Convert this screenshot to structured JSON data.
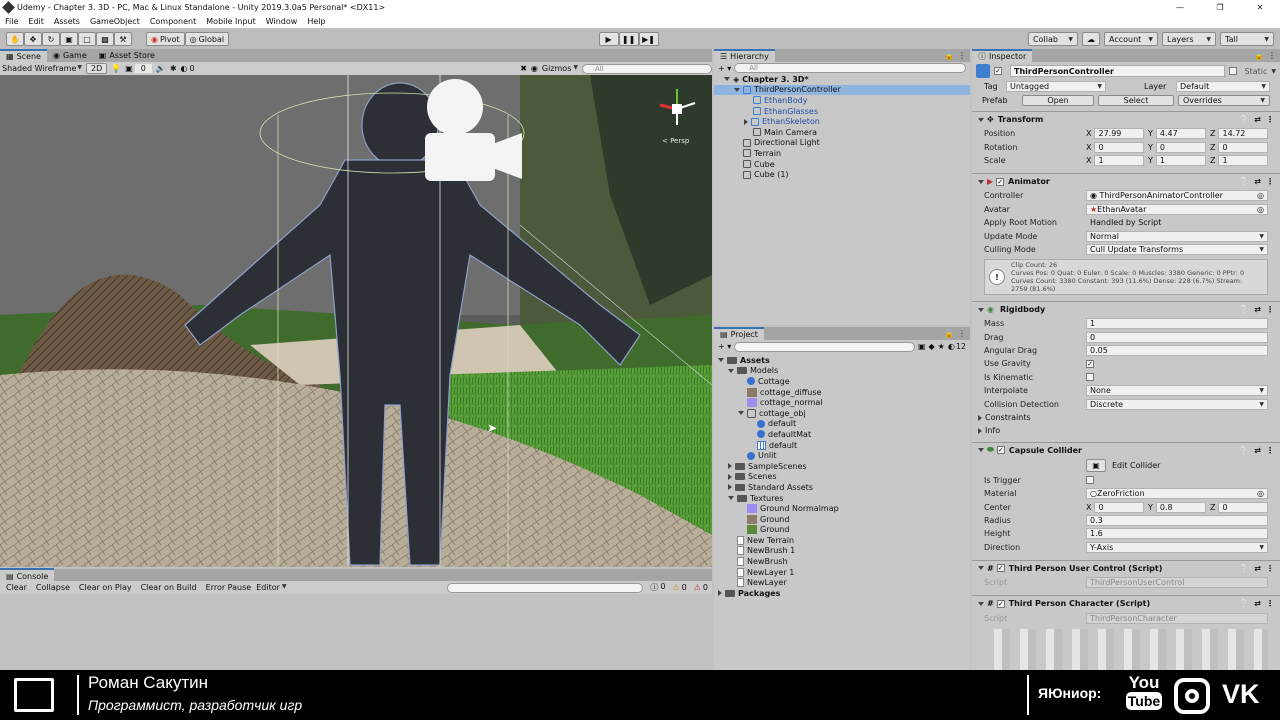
{
  "window": {
    "title": "Udemy - Chapter 3. 3D - PC, Mac & Linux Standalone - Unity 2019.3.0a5 Personal* <DX11>"
  },
  "menu": [
    "File",
    "Edit",
    "Assets",
    "GameObject",
    "Component",
    "Mobile Input",
    "Window",
    "Help"
  ],
  "toolbar": {
    "pivot": "Pivot",
    "global": "Global",
    "collab": "Collab",
    "account": "Account",
    "layers": "Layers",
    "layout": "Tall"
  },
  "scene": {
    "tabs": [
      "Scene",
      "Game",
      "Asset Store"
    ],
    "shading": "Shaded Wireframe",
    "mode2d": "2D",
    "fx_count": "0",
    "hidden_count": "0",
    "gizmos": "Gizmos",
    "search_placeholder": "All",
    "persp": "< Persp"
  },
  "console": {
    "tab": "Console",
    "buttons": [
      "Clear",
      "Collapse",
      "Clear on Play",
      "Clear on Build",
      "Error Pause",
      "Editor"
    ],
    "counts": [
      "0",
      "0",
      "0"
    ]
  },
  "hierarchy": {
    "title": "Hierarchy",
    "search_placeholder": "All",
    "scene": "Chapter 3. 3D*",
    "items": [
      {
        "label": "ThirdPersonController",
        "depth": 1,
        "blue": false,
        "selected": true,
        "arrow": "down"
      },
      {
        "label": "EthanBody",
        "depth": 2,
        "blue": true,
        "selected": false,
        "arrow": ""
      },
      {
        "label": "EthanGlasses",
        "depth": 2,
        "blue": true,
        "selected": false,
        "arrow": ""
      },
      {
        "label": "EthanSkeleton",
        "depth": 2,
        "blue": true,
        "selected": false,
        "arrow": "right"
      },
      {
        "label": "Main Camera",
        "depth": 2,
        "blue": false,
        "selected": false,
        "arrow": ""
      },
      {
        "label": "Directional Light",
        "depth": 1,
        "blue": false,
        "selected": false,
        "arrow": ""
      },
      {
        "label": "Terrain",
        "depth": 1,
        "blue": false,
        "selected": false,
        "arrow": ""
      },
      {
        "label": "Cube",
        "depth": 1,
        "blue": false,
        "selected": false,
        "arrow": ""
      },
      {
        "label": "Cube (1)",
        "depth": 1,
        "blue": false,
        "selected": false,
        "arrow": ""
      }
    ]
  },
  "project": {
    "title": "Project",
    "count": "12",
    "items": [
      {
        "label": "Assets",
        "depth": 0,
        "kind": "folder",
        "arrow": "down",
        "bold": true
      },
      {
        "label": "Models",
        "depth": 1,
        "kind": "folder",
        "arrow": "down"
      },
      {
        "label": "Cottage",
        "depth": 2,
        "kind": "sphere",
        "arrow": ""
      },
      {
        "label": "cottage_diffuse",
        "depth": 2,
        "kind": "tex",
        "arrow": ""
      },
      {
        "label": "cottage_normal",
        "depth": 2,
        "kind": "texn",
        "arrow": ""
      },
      {
        "label": "cottage_obj",
        "depth": 2,
        "kind": "prefab",
        "arrow": "down"
      },
      {
        "label": "default",
        "depth": 3,
        "kind": "sphere",
        "arrow": ""
      },
      {
        "label": "defaultMat",
        "depth": 3,
        "kind": "sphere",
        "arrow": ""
      },
      {
        "label": "default",
        "depth": 3,
        "kind": "mesh",
        "arrow": ""
      },
      {
        "label": "Unlit",
        "depth": 2,
        "kind": "sphere",
        "arrow": ""
      },
      {
        "label": "SampleScenes",
        "depth": 1,
        "kind": "folder",
        "arrow": "right"
      },
      {
        "label": "Scenes",
        "depth": 1,
        "kind": "folder",
        "arrow": "right"
      },
      {
        "label": "Standard Assets",
        "depth": 1,
        "kind": "folder",
        "arrow": "right"
      },
      {
        "label": "Textures",
        "depth": 1,
        "kind": "folder",
        "arrow": "down"
      },
      {
        "label": "Ground Normalmap",
        "depth": 2,
        "kind": "texn",
        "arrow": ""
      },
      {
        "label": "Ground",
        "depth": 2,
        "kind": "tex",
        "arrow": ""
      },
      {
        "label": "Ground",
        "depth": 2,
        "kind": "tex2",
        "arrow": ""
      },
      {
        "label": "New Terrain",
        "depth": 1,
        "kind": "file",
        "arrow": ""
      },
      {
        "label": "NewBrush 1",
        "depth": 1,
        "kind": "file",
        "arrow": ""
      },
      {
        "label": "NewBrush",
        "depth": 1,
        "kind": "file",
        "arrow": ""
      },
      {
        "label": "NewLayer 1",
        "depth": 1,
        "kind": "file",
        "arrow": ""
      },
      {
        "label": "NewLayer",
        "depth": 1,
        "kind": "file",
        "arrow": ""
      },
      {
        "label": "Packages",
        "depth": 0,
        "kind": "folder",
        "arrow": "right",
        "bold": true
      }
    ]
  },
  "inspector": {
    "title": "Inspector",
    "object_name": "ThirdPersonController",
    "static": "Static",
    "tag_label": "Tag",
    "tag": "Untagged",
    "layer_label": "Layer",
    "layer": "Default",
    "prefab_label": "Prefab",
    "open": "Open",
    "select": "Select",
    "overrides": "Overrides",
    "transform": {
      "title": "Transform",
      "position_label": "Position",
      "position": [
        "27.99",
        "4.47",
        "14.72"
      ],
      "rotation_label": "Rotation",
      "rotation": [
        "0",
        "0",
        "0"
      ],
      "scale_label": "Scale",
      "scale": [
        "1",
        "1",
        "1"
      ]
    },
    "animator": {
      "title": "Animator",
      "controller_label": "Controller",
      "controller": "ThirdPersonAnimatorController",
      "avatar_label": "Avatar",
      "avatar": "EthanAvatar",
      "root_motion_label": "Apply Root Motion",
      "root_motion": "Handled by Script",
      "update_label": "Update Mode",
      "update": "Normal",
      "culling_label": "Culling Mode",
      "culling": "Cull Update Transforms",
      "info": [
        "Clip Count: 26",
        "Curves Pos: 0 Quat: 0 Euler: 0 Scale: 0 Muscles: 3380 Generic: 0 PPtr: 0",
        "Curves Count: 3380 Constant: 393 (11.6%) Dense: 228 (6.7%) Stream:",
        "2759 (81.6%)"
      ]
    },
    "rigidbody": {
      "title": "Rigidbody",
      "mass_label": "Mass",
      "mass": "1",
      "drag_label": "Drag",
      "drag": "0",
      "angular_label": "Angular Drag",
      "angular": "0.05",
      "gravity_label": "Use Gravity",
      "kinematic_label": "Is Kinematic",
      "interp_label": "Interpolate",
      "interp": "None",
      "collision_label": "Collision Detection",
      "collision": "Discrete",
      "constraints": "Constraints",
      "info": "Info"
    },
    "capsule": {
      "title": "Capsule Collider",
      "edit": "Edit Collider",
      "trigger_label": "Is Trigger",
      "material_label": "Material",
      "material": "ZeroFriction",
      "center_label": "Center",
      "center": [
        "0",
        "0.8",
        "0"
      ],
      "radius_label": "Radius",
      "radius": "0.3",
      "height_label": "Height",
      "height": "1.6",
      "direction_label": "Direction",
      "direction": "Y-Axis"
    },
    "user_control": {
      "title": "Third Person User Control (Script)",
      "script_label": "Script",
      "script": "ThirdPersonUserControl"
    },
    "character": {
      "title": "Third Person Character (Script)",
      "script_label": "Script",
      "script": "ThirdPersonCharacter"
    }
  },
  "banner": {
    "name": "Роман Сакутин",
    "subtitle": "Программист, разработчик игр",
    "brand": "ЯЮниор:",
    "youtube_top": "You",
    "youtube_bottom": "Tube"
  }
}
